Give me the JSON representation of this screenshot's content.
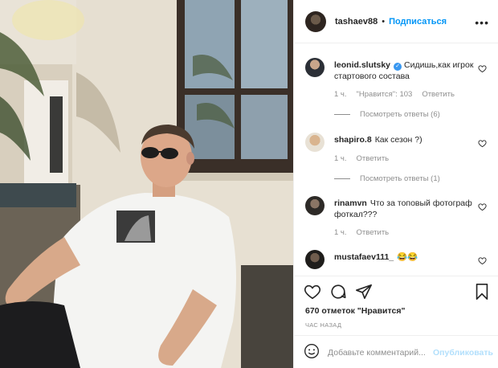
{
  "post": {
    "author": "tashaev88",
    "follow_label": "Подписаться",
    "separator": "•",
    "more_label": "•••"
  },
  "comments": [
    {
      "username": "leonid.slutsky",
      "verified": true,
      "text": "Сидишь,как игрок стартового состава",
      "time": "1 ч.",
      "likes": "\"Нравится\": 103",
      "reply": "Ответить",
      "view_replies": "Посмотреть ответы (6)"
    },
    {
      "username": "shapiro.8",
      "verified": false,
      "text": "Как сезон ?)",
      "time": "1 ч.",
      "reply": "Ответить",
      "view_replies": "Посмотреть ответы (1)"
    },
    {
      "username": "rinamvn",
      "verified": false,
      "text": "Что за топовый фотограф фоткал???",
      "time": "1 ч.",
      "reply": "Ответить"
    },
    {
      "username": "mustafaev111_",
      "verified": false,
      "text": "😂😂"
    }
  ],
  "actions": {
    "likes_count": "670 отметок \"Нравится\"",
    "time": "ЧАС НАЗАД"
  },
  "add_comment": {
    "placeholder": "Добавьте комментарий...",
    "publish_label": "Опубликовать"
  },
  "icons": {
    "heart": "heart-icon",
    "comment": "comment-icon",
    "share": "share-icon",
    "bookmark": "bookmark-icon",
    "emoji": "emoji-icon",
    "more": "more-icon"
  },
  "colors": {
    "link": "#0095f6",
    "verified": "#3897f0",
    "muted": "#8e8e8e",
    "publish_disabled": "#b2dffc"
  }
}
